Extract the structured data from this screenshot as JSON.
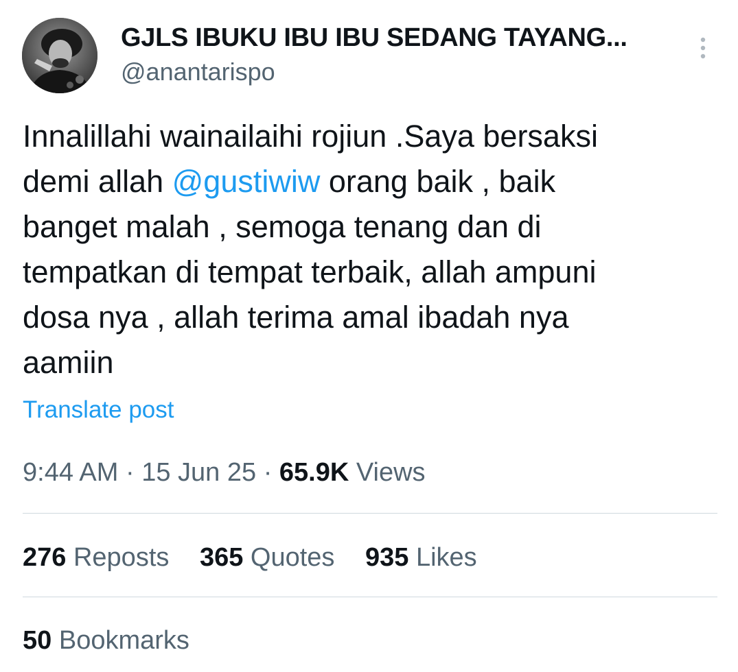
{
  "author": {
    "display_name": "GJLS IBUKU IBU IBU SEDANG TAYANG...",
    "handle": "@anantarispo"
  },
  "tweet": {
    "lines": [
      {
        "before": "Innalillahi wainailaihi rojiun .Saya bersaksi",
        "mention": "",
        "after": ""
      },
      {
        "before": "demi allah ",
        "mention": "@gustiwiw",
        "after": " orang baik , baik"
      },
      {
        "before": "banget malah , semoga tenang dan di",
        "mention": "",
        "after": ""
      },
      {
        "before": "tempatkan di tempat terbaik, allah ampuni",
        "mention": "",
        "after": ""
      },
      {
        "before": "dosa nya , allah terima amal ibadah nya",
        "mention": "",
        "after": ""
      },
      {
        "before": "aamiin",
        "mention": "",
        "after": ""
      }
    ],
    "translate_label": "Translate post"
  },
  "meta": {
    "time": "9:44 AM",
    "separator": "·",
    "date": "15 Jun 25",
    "views_count": "65.9K",
    "views_label": "Views"
  },
  "stats": {
    "reposts_count": "276",
    "reposts_label": "Reposts",
    "quotes_count": "365",
    "quotes_label": "Quotes",
    "likes_count": "935",
    "likes_label": "Likes",
    "bookmarks_count": "50",
    "bookmarks_label": "Bookmarks"
  },
  "icons": {
    "more": "more-vertical-icon"
  },
  "colors": {
    "text": "#0f1419",
    "secondary": "#536471",
    "link": "#1d9bf0",
    "divider": "#cfd9de"
  }
}
